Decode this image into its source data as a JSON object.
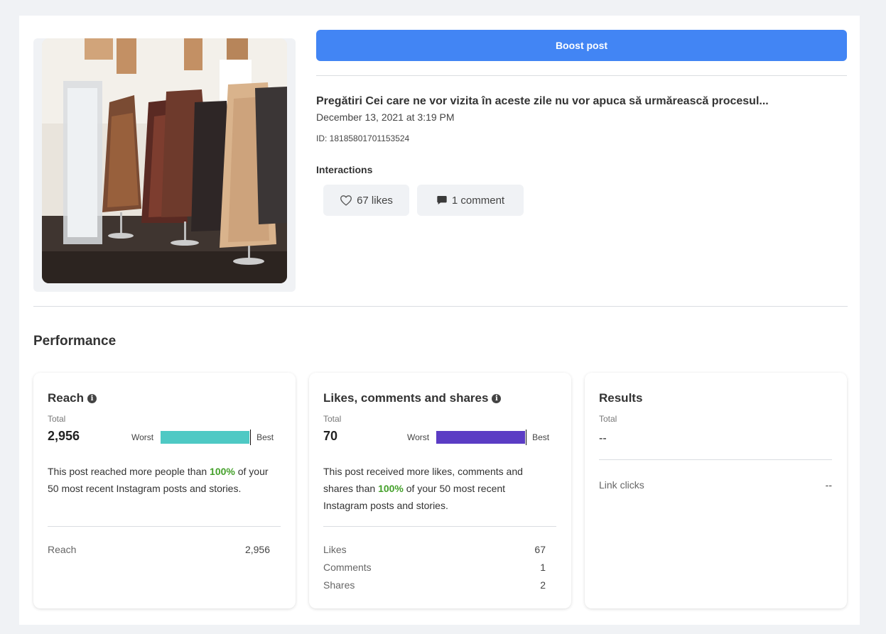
{
  "boost_button": "Boost post",
  "post": {
    "title": "Pregătiri Cei care ne vor vizita în aceste zile nu vor apuca să urmărească procesul...",
    "date": "December 13, 2021 at 3:19 PM",
    "id": "ID: 18185801701153524",
    "interactions_label": "Interactions",
    "likes_label": "67 likes",
    "comment_label": "1 comment"
  },
  "performance": {
    "title": "Performance",
    "reach": {
      "title": "Reach",
      "total_label": "Total",
      "total": "2,956",
      "worst": "Worst",
      "best": "Best",
      "bar_fill_fraction": 1.0,
      "bar_color": "#4ec9c4",
      "desc_pre": "This post reached more people than ",
      "desc_pct": "100%",
      "desc_post": " of your 50 most recent Instagram posts and stories.",
      "rows": [
        {
          "label": "Reach",
          "value": "2,956"
        }
      ]
    },
    "engagement": {
      "title": "Likes, comments and shares",
      "total_label": "Total",
      "total": "70",
      "worst": "Worst",
      "best": "Best",
      "bar_fill_fraction": 1.0,
      "bar_color": "#5b3cc4",
      "desc_pre": "This post received more likes, comments and shares than ",
      "desc_pct": "100%",
      "desc_post": " of your 50 most recent Instagram posts and stories.",
      "rows": [
        {
          "label": "Likes",
          "value": "67"
        },
        {
          "label": "Comments",
          "value": "1"
        },
        {
          "label": "Shares",
          "value": "2"
        }
      ]
    },
    "results": {
      "title": "Results",
      "total_label": "Total",
      "total": "--",
      "rows": [
        {
          "label": "Link clicks",
          "value": "--"
        }
      ]
    }
  },
  "colors": {
    "accent": "#4285f4",
    "positive": "#44a02a"
  },
  "icons": {
    "likes": "heart-icon",
    "comment": "comment-bubble-icon",
    "info": "info-icon"
  }
}
